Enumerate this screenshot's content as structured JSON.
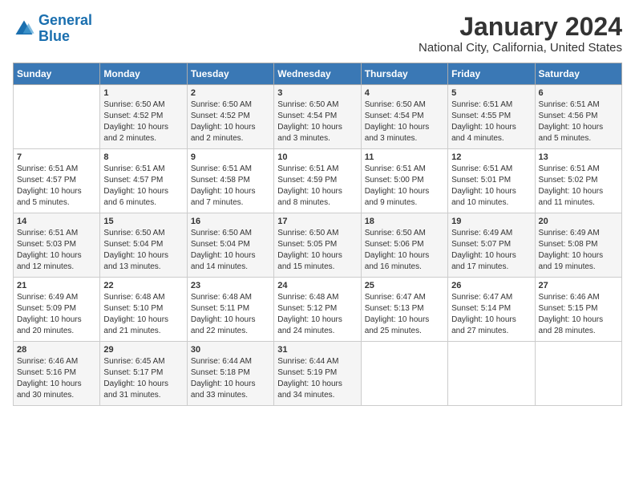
{
  "header": {
    "logo_line1": "General",
    "logo_line2": "Blue",
    "month": "January 2024",
    "location": "National City, California, United States"
  },
  "days_of_week": [
    "Sunday",
    "Monday",
    "Tuesday",
    "Wednesday",
    "Thursday",
    "Friday",
    "Saturday"
  ],
  "weeks": [
    [
      {
        "num": "",
        "info": ""
      },
      {
        "num": "1",
        "info": "Sunrise: 6:50 AM\nSunset: 4:52 PM\nDaylight: 10 hours\nand 2 minutes."
      },
      {
        "num": "2",
        "info": "Sunrise: 6:50 AM\nSunset: 4:52 PM\nDaylight: 10 hours\nand 2 minutes."
      },
      {
        "num": "3",
        "info": "Sunrise: 6:50 AM\nSunset: 4:54 PM\nDaylight: 10 hours\nand 3 minutes."
      },
      {
        "num": "4",
        "info": "Sunrise: 6:50 AM\nSunset: 4:54 PM\nDaylight: 10 hours\nand 3 minutes."
      },
      {
        "num": "5",
        "info": "Sunrise: 6:51 AM\nSunset: 4:55 PM\nDaylight: 10 hours\nand 4 minutes."
      },
      {
        "num": "6",
        "info": "Sunrise: 6:51 AM\nSunset: 4:56 PM\nDaylight: 10 hours\nand 5 minutes."
      }
    ],
    [
      {
        "num": "7",
        "info": "Sunrise: 6:51 AM\nSunset: 4:57 PM\nDaylight: 10 hours\nand 5 minutes."
      },
      {
        "num": "8",
        "info": "Sunrise: 6:51 AM\nSunset: 4:57 PM\nDaylight: 10 hours\nand 6 minutes."
      },
      {
        "num": "9",
        "info": "Sunrise: 6:51 AM\nSunset: 4:58 PM\nDaylight: 10 hours\nand 7 minutes."
      },
      {
        "num": "10",
        "info": "Sunrise: 6:51 AM\nSunset: 4:59 PM\nDaylight: 10 hours\nand 8 minutes."
      },
      {
        "num": "11",
        "info": "Sunrise: 6:51 AM\nSunset: 5:00 PM\nDaylight: 10 hours\nand 9 minutes."
      },
      {
        "num": "12",
        "info": "Sunrise: 6:51 AM\nSunset: 5:01 PM\nDaylight: 10 hours\nand 10 minutes."
      },
      {
        "num": "13",
        "info": "Sunrise: 6:51 AM\nSunset: 5:02 PM\nDaylight: 10 hours\nand 11 minutes."
      }
    ],
    [
      {
        "num": "14",
        "info": "Sunrise: 6:51 AM\nSunset: 5:03 PM\nDaylight: 10 hours\nand 12 minutes."
      },
      {
        "num": "15",
        "info": "Sunrise: 6:50 AM\nSunset: 5:04 PM\nDaylight: 10 hours\nand 13 minutes."
      },
      {
        "num": "16",
        "info": "Sunrise: 6:50 AM\nSunset: 5:04 PM\nDaylight: 10 hours\nand 14 minutes."
      },
      {
        "num": "17",
        "info": "Sunrise: 6:50 AM\nSunset: 5:05 PM\nDaylight: 10 hours\nand 15 minutes."
      },
      {
        "num": "18",
        "info": "Sunrise: 6:50 AM\nSunset: 5:06 PM\nDaylight: 10 hours\nand 16 minutes."
      },
      {
        "num": "19",
        "info": "Sunrise: 6:49 AM\nSunset: 5:07 PM\nDaylight: 10 hours\nand 17 minutes."
      },
      {
        "num": "20",
        "info": "Sunrise: 6:49 AM\nSunset: 5:08 PM\nDaylight: 10 hours\nand 19 minutes."
      }
    ],
    [
      {
        "num": "21",
        "info": "Sunrise: 6:49 AM\nSunset: 5:09 PM\nDaylight: 10 hours\nand 20 minutes."
      },
      {
        "num": "22",
        "info": "Sunrise: 6:48 AM\nSunset: 5:10 PM\nDaylight: 10 hours\nand 21 minutes."
      },
      {
        "num": "23",
        "info": "Sunrise: 6:48 AM\nSunset: 5:11 PM\nDaylight: 10 hours\nand 22 minutes."
      },
      {
        "num": "24",
        "info": "Sunrise: 6:48 AM\nSunset: 5:12 PM\nDaylight: 10 hours\nand 24 minutes."
      },
      {
        "num": "25",
        "info": "Sunrise: 6:47 AM\nSunset: 5:13 PM\nDaylight: 10 hours\nand 25 minutes."
      },
      {
        "num": "26",
        "info": "Sunrise: 6:47 AM\nSunset: 5:14 PM\nDaylight: 10 hours\nand 27 minutes."
      },
      {
        "num": "27",
        "info": "Sunrise: 6:46 AM\nSunset: 5:15 PM\nDaylight: 10 hours\nand 28 minutes."
      }
    ],
    [
      {
        "num": "28",
        "info": "Sunrise: 6:46 AM\nSunset: 5:16 PM\nDaylight: 10 hours\nand 30 minutes."
      },
      {
        "num": "29",
        "info": "Sunrise: 6:45 AM\nSunset: 5:17 PM\nDaylight: 10 hours\nand 31 minutes."
      },
      {
        "num": "30",
        "info": "Sunrise: 6:44 AM\nSunset: 5:18 PM\nDaylight: 10 hours\nand 33 minutes."
      },
      {
        "num": "31",
        "info": "Sunrise: 6:44 AM\nSunset: 5:19 PM\nDaylight: 10 hours\nand 34 minutes."
      },
      {
        "num": "",
        "info": ""
      },
      {
        "num": "",
        "info": ""
      },
      {
        "num": "",
        "info": ""
      }
    ]
  ]
}
